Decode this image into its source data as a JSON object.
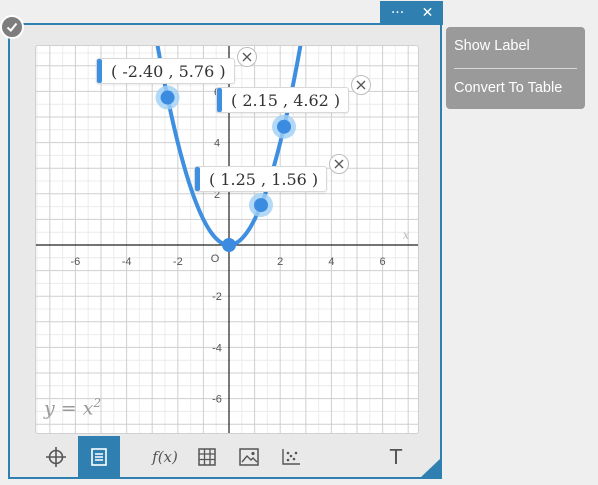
{
  "window": {
    "more_label": "···",
    "close_label": "✕"
  },
  "context_menu": {
    "items": [
      "Show Label",
      "Convert To Table"
    ]
  },
  "graph": {
    "function_label": "y = x",
    "function_exponent": "2",
    "origin_label": "O",
    "x_axis_label": "x",
    "x_ticks": [
      "-6",
      "-4",
      "-2",
      "2",
      "4",
      "6"
    ],
    "y_ticks": [
      "6",
      "4",
      "2",
      "-2",
      "-4",
      "-6"
    ],
    "points": [
      {
        "x": -2.4,
        "y": 5.76,
        "label": "( -2.40 , 5.76 )"
      },
      {
        "x": 2.15,
        "y": 4.62,
        "label": "( 2.15 , 4.62 )"
      },
      {
        "x": 1.25,
        "y": 1.56,
        "label": "( 1.25 , 1.56 )"
      },
      {
        "x": 0,
        "y": 0
      }
    ],
    "curve_color": "#3f8fe0",
    "point_color": "#3b8be0"
  },
  "toolbar": {
    "tools": [
      "crosshair-tool",
      "list-tool",
      "function-tool",
      "table-tool",
      "image-tool",
      "scatter-tool",
      "text-tool"
    ],
    "fx_label": "f(x)",
    "text_label": "T",
    "active_tool": "list-tool"
  },
  "colors": {
    "accent": "#2f7fb0",
    "menu_bg": "#9a9a9a"
  }
}
